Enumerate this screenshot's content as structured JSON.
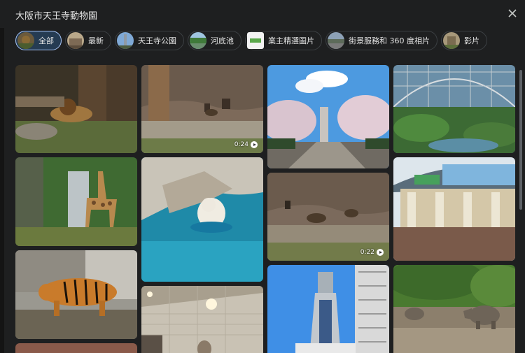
{
  "dialog": {
    "title": "大阪市天王寺動物園"
  },
  "chips": [
    {
      "label": "全部",
      "thumb": "zoo-thumb",
      "active": true
    },
    {
      "label": "最新",
      "thumb": "building-thumb",
      "active": false
    },
    {
      "label": "天王寺公園",
      "thumb": "tower-thumb",
      "active": false
    },
    {
      "label": "河底池",
      "thumb": "pond-thumb",
      "active": false
    },
    {
      "label": "業主精選圖片",
      "thumb": "owner-thumb",
      "active": false
    },
    {
      "label": "街景服務和 360 度相片",
      "thumb": "street-thumb",
      "active": false
    },
    {
      "label": "影片",
      "thumb": "video-thumb",
      "active": false
    }
  ],
  "photos": [
    {
      "subject": "lion"
    },
    {
      "subject": "monkeys",
      "duration": "0:24"
    },
    {
      "subject": "cherry-blossom-path"
    },
    {
      "subject": "aviary-dome"
    },
    {
      "subject": "giraffe"
    },
    {
      "subject": "polar-bear"
    },
    {
      "subject": "monkeys-2",
      "duration": "0:22"
    },
    {
      "subject": "zoo-entrance"
    },
    {
      "subject": "tiger"
    },
    {
      "subject": "tsutenkaku-tower"
    },
    {
      "subject": "rhino"
    },
    {
      "subject": "indoor-animal"
    },
    {
      "subject": "partial-tile"
    }
  ]
}
